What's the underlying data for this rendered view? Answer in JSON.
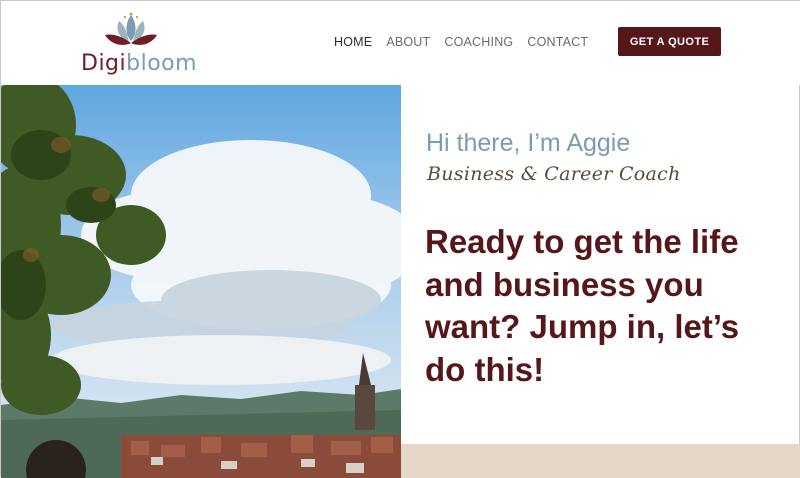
{
  "logo": {
    "part1": "Digi",
    "part2": "bloom"
  },
  "nav": {
    "items": [
      {
        "label": "HOME",
        "active": true
      },
      {
        "label": "ABOUT",
        "active": false
      },
      {
        "label": "COACHING",
        "active": false
      },
      {
        "label": "CONTACT",
        "active": false
      }
    ]
  },
  "cta": {
    "label": "GET A QUOTE"
  },
  "hero": {
    "greeting": "Hi there, I’m Aggie",
    "subtitle": "Business & Career Coach",
    "headline": "Ready to get the life and business you want? Jump in, let’s do this!"
  },
  "colors": {
    "brand_dark": "#55171a",
    "brand_blue": "#7c9cb0",
    "beige": "#e6d6c6"
  }
}
